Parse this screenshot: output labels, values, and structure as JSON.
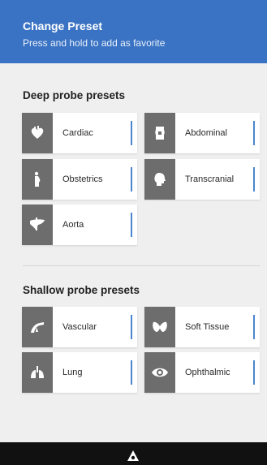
{
  "header": {
    "title": "Change Preset",
    "subtitle": "Press and hold to add as favorite"
  },
  "deep": {
    "title": "Deep probe presets",
    "items": [
      {
        "label": "Cardiac",
        "icon": "heart-icon"
      },
      {
        "label": "Abdominal",
        "icon": "abdomen-icon"
      },
      {
        "label": "Obstetrics",
        "icon": "pregnant-icon"
      },
      {
        "label": "Transcranial",
        "icon": "head-icon"
      },
      {
        "label": "Aorta",
        "icon": "liver-icon"
      }
    ]
  },
  "shallow": {
    "title": "Shallow probe presets",
    "items": [
      {
        "label": "Vascular",
        "icon": "vessel-icon"
      },
      {
        "label": "Soft Tissue",
        "icon": "thyroid-icon"
      },
      {
        "label": "Lung",
        "icon": "lungs-icon"
      },
      {
        "label": "Ophthalmic",
        "icon": "eye-icon"
      }
    ]
  },
  "colors": {
    "header": "#3a73c3",
    "accent": "#4a86cf",
    "icon_tile": "#6d6d6d",
    "background": "#efefef"
  },
  "navbar": {
    "icon": "home-triangle-icon"
  }
}
